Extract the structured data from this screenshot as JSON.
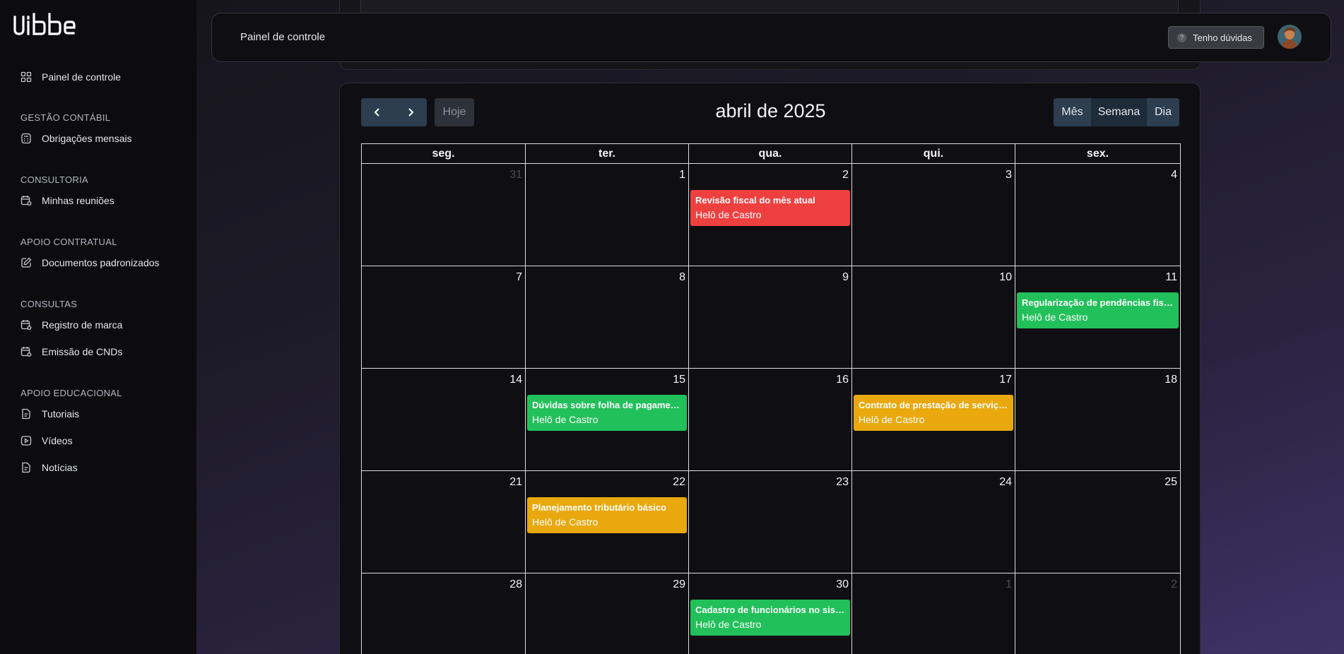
{
  "brand": {
    "logo_text": "vibbe"
  },
  "sidebar": {
    "top_item": {
      "label": "Painel de controle",
      "icon": "grid-icon"
    },
    "sections": [
      {
        "label": "GESTÃO CONTÁBIL",
        "items": [
          {
            "label": "Obrigações mensais",
            "icon": "calculator-icon"
          }
        ]
      },
      {
        "label": "CONSULTORIA",
        "items": [
          {
            "label": "Minhas reuniões",
            "icon": "calendar-icon"
          }
        ]
      },
      {
        "label": "APOIO CONTRATUAL",
        "items": [
          {
            "label": "Documentos padronizados",
            "icon": "edit-icon"
          }
        ]
      },
      {
        "label": "CONSULTAS",
        "items": [
          {
            "label": "Registro de marca",
            "icon": "calendar-icon"
          },
          {
            "label": "Emissão de CNDs",
            "icon": "calendar-icon"
          }
        ]
      },
      {
        "label": "APOIO EDUCACIONAL",
        "items": [
          {
            "label": "Tutoriais",
            "icon": "document-icon"
          },
          {
            "label": "Vídeos",
            "icon": "play-icon"
          },
          {
            "label": "Notícias",
            "icon": "document-icon"
          }
        ]
      }
    ]
  },
  "header": {
    "title": "Painel de controle",
    "help_button": "Tenho dúvidas"
  },
  "calendar": {
    "title": "abril de 2025",
    "today_label": "Hoje",
    "views": [
      "Mês",
      "Semana",
      "Dia"
    ],
    "active_view": "Semana",
    "weekdays": [
      "seg.",
      "ter.",
      "qua.",
      "qui.",
      "sex."
    ],
    "weeks": [
      [
        {
          "day": "31",
          "muted": true
        },
        {
          "day": "1"
        },
        {
          "day": "2",
          "event": {
            "title": "Revisão fiscal do mês atual",
            "sub": "Helô de Castro",
            "color": "red"
          }
        },
        {
          "day": "3"
        },
        {
          "day": "4"
        }
      ],
      [
        {
          "day": "7"
        },
        {
          "day": "8"
        },
        {
          "day": "9"
        },
        {
          "day": "10"
        },
        {
          "day": "11",
          "event": {
            "title": "Regularização de pendências fiscais",
            "sub": "Helô de Castro",
            "color": "green"
          }
        }
      ],
      [
        {
          "day": "14"
        },
        {
          "day": "15",
          "event": {
            "title": "Dúvidas sobre folha de pagamento",
            "sub": "Helô de Castro",
            "color": "green"
          }
        },
        {
          "day": "16"
        },
        {
          "day": "17",
          "event": {
            "title": "Contrato de prestação de serviços",
            "sub": "Helô de Castro",
            "color": "yellow"
          }
        },
        {
          "day": "18"
        }
      ],
      [
        {
          "day": "21"
        },
        {
          "day": "22",
          "event": {
            "title": "Planejamento tributário básico",
            "sub": "Helô de Castro",
            "color": "yellow"
          }
        },
        {
          "day": "23"
        },
        {
          "day": "24"
        },
        {
          "day": "25"
        }
      ],
      [
        {
          "day": "28"
        },
        {
          "day": "29"
        },
        {
          "day": "30",
          "event": {
            "title": "Cadastro de funcionários no sistema",
            "sub": "Helô de Castro",
            "color": "green"
          }
        },
        {
          "day": "1",
          "muted": true
        },
        {
          "day": "2",
          "muted": true
        }
      ]
    ]
  },
  "colors": {
    "red": "#ef4040",
    "green": "#22c05a",
    "yellow": "#e8a80e",
    "sidebar_bg": "#0c0c0f"
  }
}
